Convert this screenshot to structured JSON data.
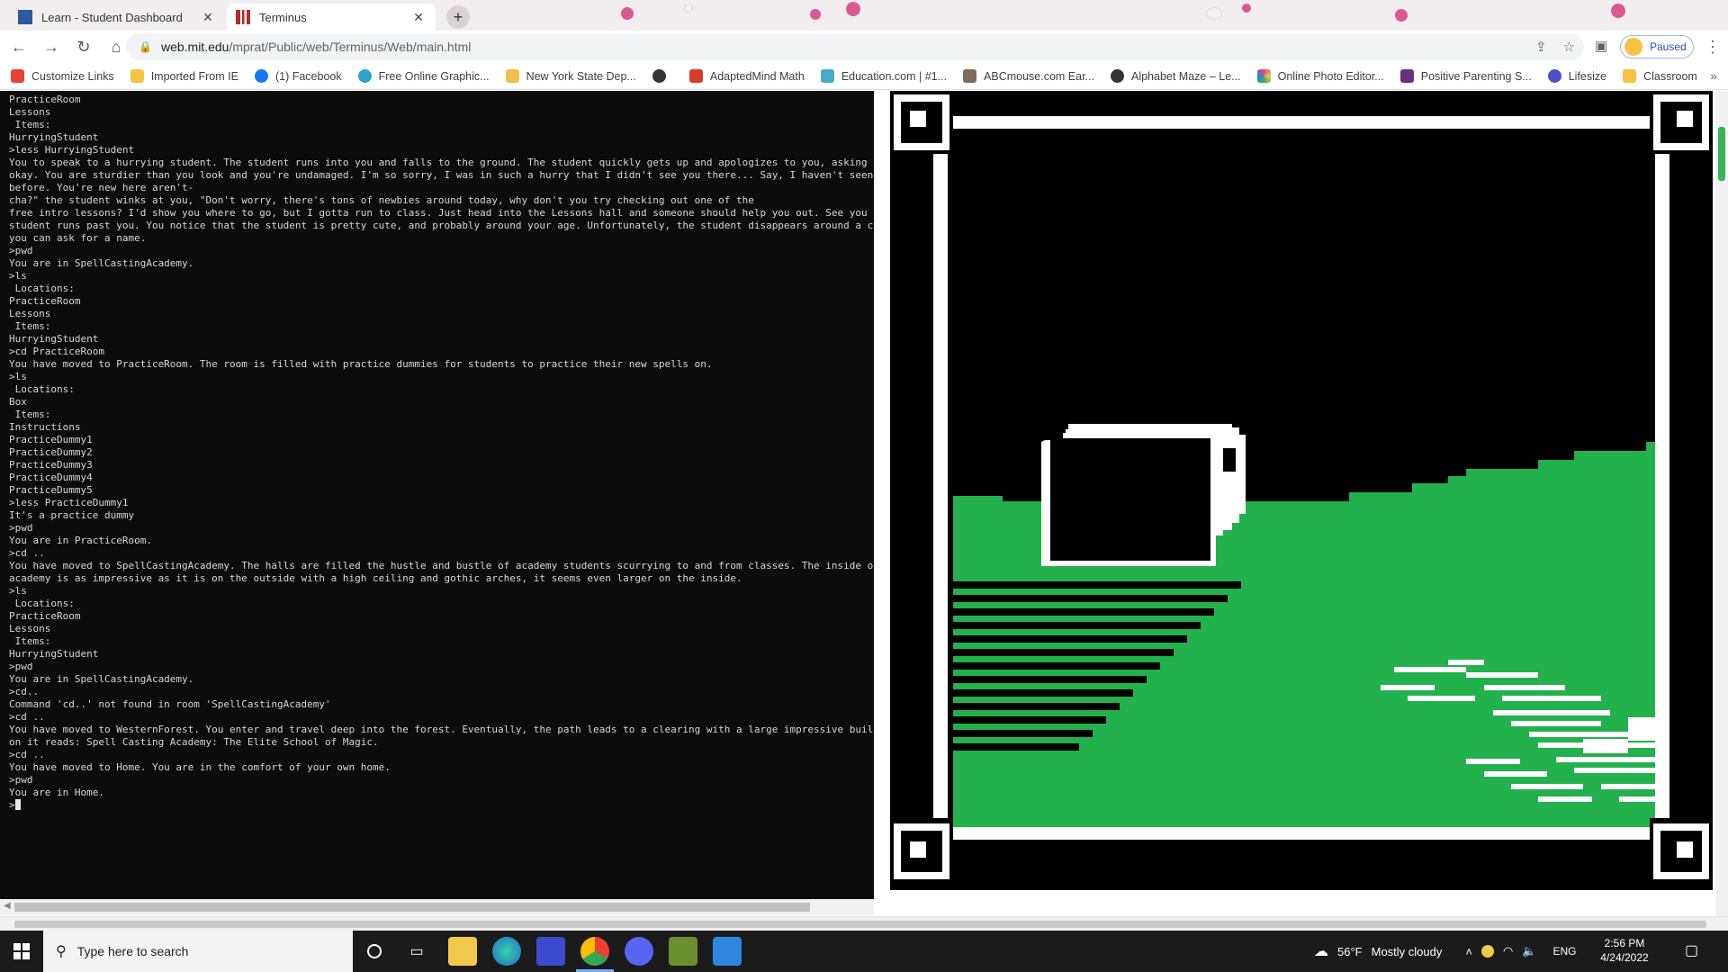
{
  "browser": {
    "tabs": [
      {
        "title": "Learn - Student Dashboard",
        "active": false
      },
      {
        "title": "Terminus",
        "active": true
      }
    ],
    "url_host": "web.mit.edu",
    "url_path": "/mprat/Public/web/Terminus/Web/main.html",
    "profile_status": "Paused",
    "bookmarks": [
      {
        "label": "Customize Links",
        "color": "#e94235"
      },
      {
        "label": "Imported From IE",
        "color": "#f6c443"
      },
      {
        "label": "(1) Facebook",
        "color": "#1877f2"
      },
      {
        "label": "Free Online Graphic...",
        "color": "#2ea3c8"
      },
      {
        "label": "New York State Dep...",
        "color": "#f0c04a"
      },
      {
        "label": "",
        "color": "#333333"
      },
      {
        "label": "AdaptedMind Math",
        "color": "#d83a2e"
      },
      {
        "label": "Education.com | #1...",
        "color": "#49a9c9"
      },
      {
        "label": "ABCmouse.com Ear...",
        "color": "#7c6a5a"
      },
      {
        "label": "Alphabet Maze – Le...",
        "color": "#333333"
      },
      {
        "label": "Online Photo Editor...",
        "color": "#e24a8a"
      },
      {
        "label": "Positive Parenting S...",
        "color": "#6a2f7a"
      },
      {
        "label": "Lifesize",
        "color": "#4a52c8"
      },
      {
        "label": "Classroom",
        "color": "#f6c443"
      }
    ]
  },
  "terminal": {
    "lines": [
      "PracticeRoom",
      "Lessons",
      " Items:",
      "HurryingStudent",
      ">less HurryingStudent",
      "You to speak to a hurrying student. The student runs into you and falls to the ground. The student quickly gets up and apologizes to you, asking i",
      "okay. You are sturdier than you look and you're undamaged. I'm so sorry, I was in such a hurry that I didn't see you there... Say, I haven't seen",
      "before. You're new here aren't-",
      "cha?\" the student winks at you, \"Don't worry, there's tons of newbies around today, why don't you try checking out one of the",
      "free intro lessons? I'd show you where to go, but I gotta run to class. Just head into the Lessons hall and someone should help you out. See you a",
      "student runs past you. You notice that the student is pretty cute, and probably around your age. Unfortunately, the student disappears around a co",
      "you can ask for a name.",
      ">pwd",
      "You are in SpellCastingAcademy.",
      ">ls",
      " Locations:",
      "PracticeRoom",
      "Lessons",
      " Items:",
      "HurryingStudent",
      ">cd PracticeRoom",
      "You have moved to PracticeRoom. The room is filled with practice dummies for students to practice their new spells on.",
      ">ls",
      " Locations:",
      "Box",
      " Items:",
      "Instructions",
      "PracticeDummy1",
      "PracticeDummy2",
      "PracticeDummy3",
      "PracticeDummy4",
      "PracticeDummy5",
      ">less PracticeDummy1",
      "It's a practice dummy",
      ">pwd",
      "You are in PracticeRoom.",
      ">cd ..",
      "You have moved to SpellCastingAcademy. The halls are filled the hustle and bustle of academy students scurrying to and from classes. The inside of",
      "academy is as impressive as it is on the outside with a high ceiling and gothic arches, it seems even larger on the inside.",
      ">ls",
      " Locations:",
      "PracticeRoom",
      "Lessons",
      " Items:",
      "HurryingStudent",
      ">pwd",
      "You are in SpellCastingAcademy.",
      ">cd..",
      "Command 'cd..' not found in room 'SpellCastingAcademy'",
      ">cd ..",
      "You have moved to WesternForest. You enter and travel deep into the forest. Eventually, the path leads to a clearing with a large impressive build",
      "on it reads: Spell Casting Academy: The Elite School of Magic.",
      ">cd ..",
      "You have moved to Home. You are in the comfort of your own home.",
      ">pwd",
      "You are in Home."
    ],
    "prompt": ">"
  },
  "scene": {
    "sky_color": "#000000",
    "grass_color": "#22b14c",
    "frame_color": "#ffffff"
  },
  "taskbar": {
    "search_placeholder": "Type here to search",
    "weather_temp": "56°F",
    "weather_text": "Mostly cloudy",
    "language": "ENG",
    "time": "2:56 PM",
    "date": "4/24/2022"
  }
}
